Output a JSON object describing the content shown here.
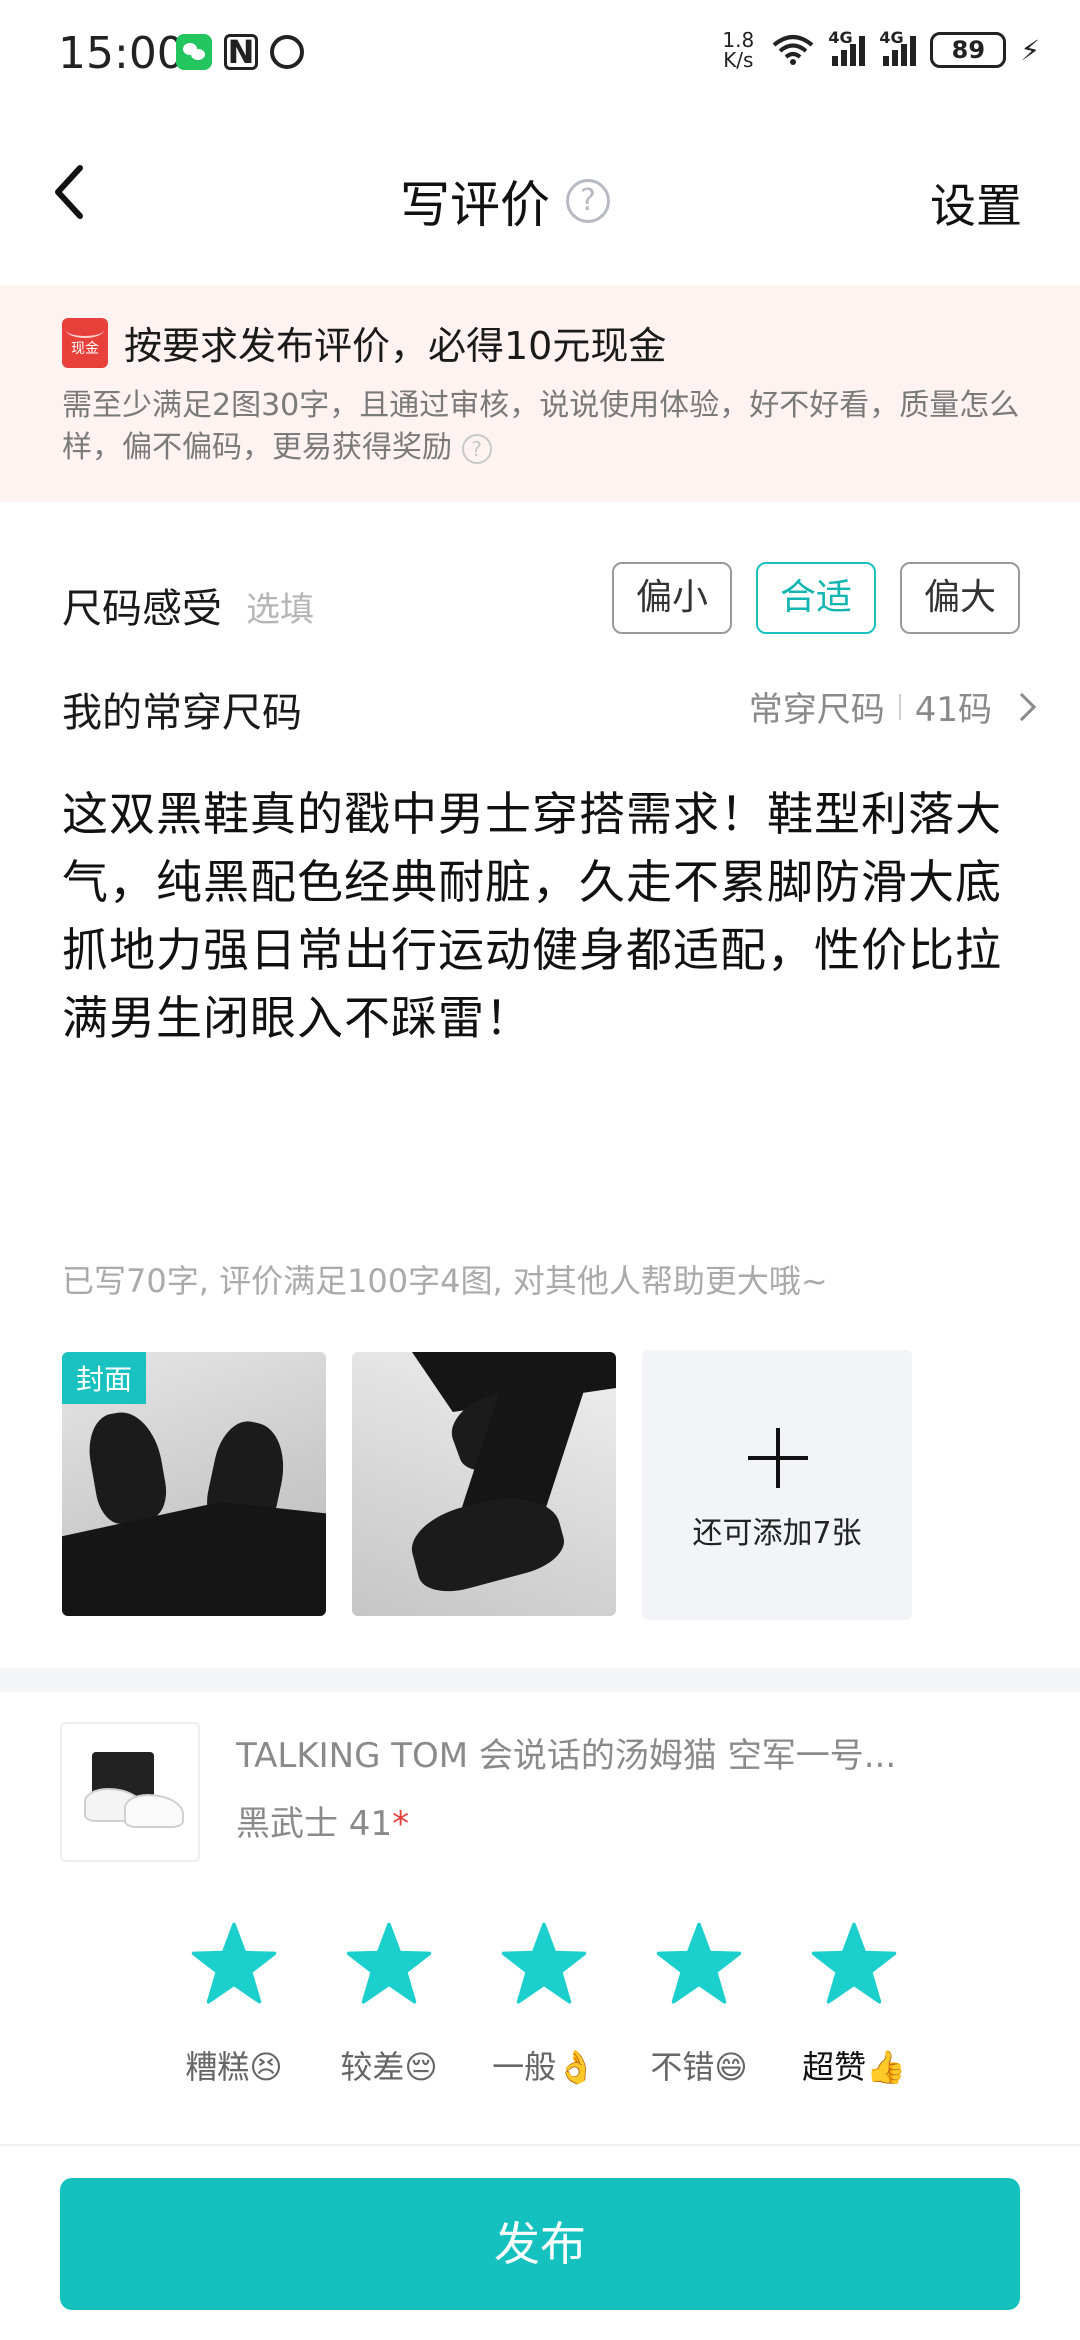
{
  "status_bar": {
    "time": "15:00",
    "net_speed": "1.8\nK/s",
    "signal1": "4G",
    "signal2": "4G",
    "battery": "89"
  },
  "nav": {
    "title": "写评价",
    "help": "?",
    "settings": "设置"
  },
  "banner": {
    "icon_text": "现金",
    "title": "按要求发布评价，必得10元现金",
    "desc": "需至少满足2图30字，且通过审核，说说使用体验，好不好看，质量怎么样，偏不偏码，更易获得奖励",
    "help": "?"
  },
  "size_feel": {
    "label": "尺码感受",
    "optional": "选填",
    "options": [
      "偏小",
      "合适",
      "偏大"
    ],
    "selected": "合适"
  },
  "usual_size": {
    "label": "我的常穿尺码",
    "value_label": "常穿尺码",
    "value": "41码"
  },
  "review": {
    "text": "这双黑鞋真的戳中男士穿搭需求！鞋型利落大气，纯黑配色经典耐脏，久走不累脚防滑大底抓地力强日常出行运动健身都适配，性价比拉满男生闭眼入不踩雷！",
    "hint": "已写70字, 评价满足100字4图, 对其他人帮助更大哦~"
  },
  "photos": {
    "cover_tag": "封面",
    "add_text": "还可添加7张"
  },
  "product": {
    "name": "TALKING TOM 会说话的汤姆猫 空军一号...",
    "spec": "黑武士 41",
    "required_mark": "*"
  },
  "rating": {
    "stars": 5,
    "star_color": "#1bcfcd",
    "labels": [
      "糟糕😣",
      "较差😔",
      "一般👌",
      "不错😄",
      "超赞👍"
    ],
    "selected_label": "超赞👍"
  },
  "publish_button": "发布",
  "colors": {
    "accent": "#14c1bf",
    "banner_bg": "#fff3f1",
    "cash_red": "#e8413c"
  }
}
